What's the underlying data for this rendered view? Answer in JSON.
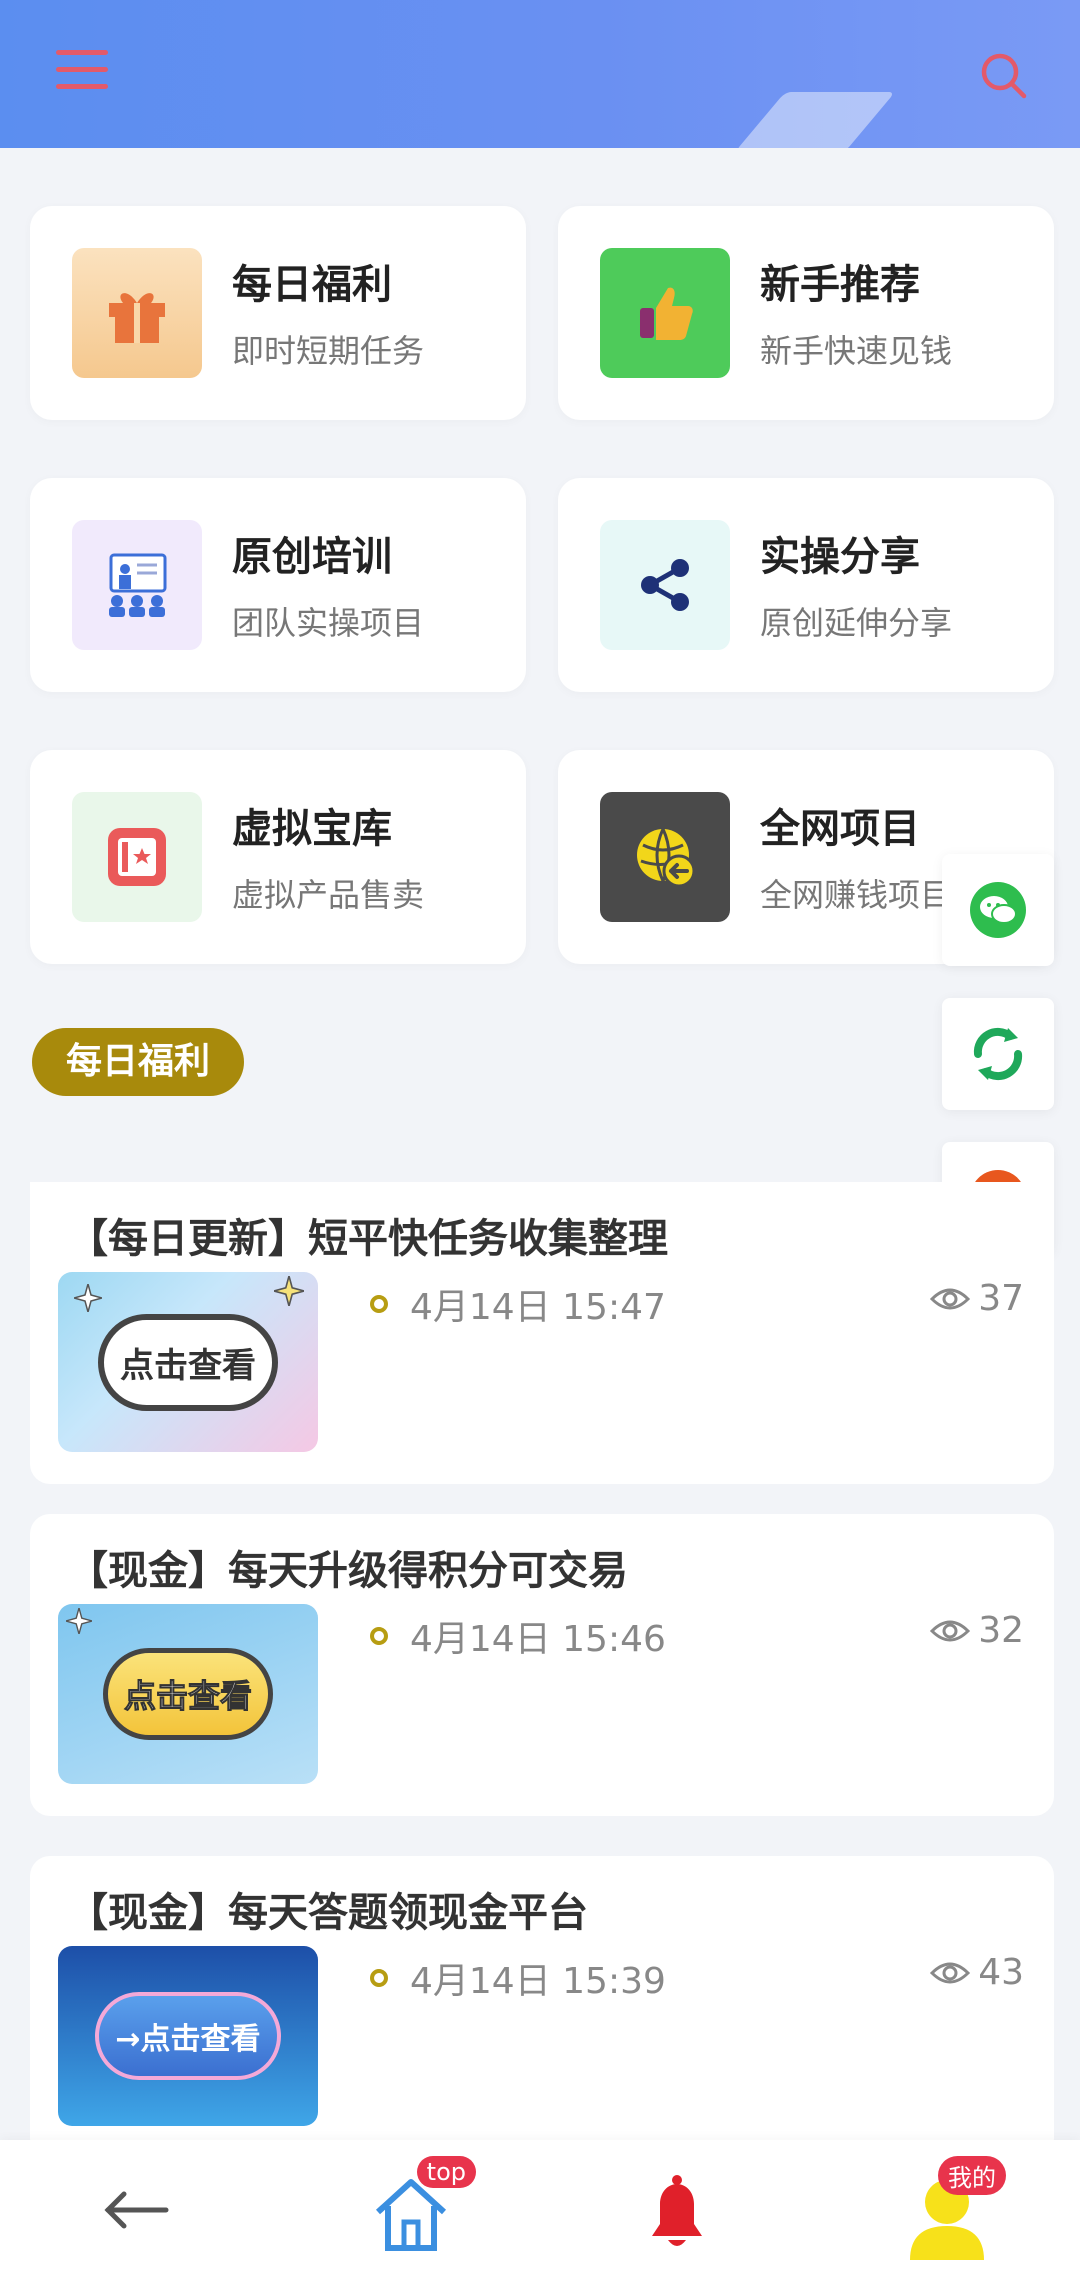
{
  "grid_items": [
    {
      "title": "每日福利",
      "subtitle": "即时短期任务",
      "icon": "gift-icon"
    },
    {
      "title": "新手推荐",
      "subtitle": "新手快速见钱",
      "icon": "thumbs-up-icon"
    },
    {
      "title": "原创培训",
      "subtitle": "团队实操项目",
      "icon": "training-icon"
    },
    {
      "title": "实操分享",
      "subtitle": "原创延伸分享",
      "icon": "share-icon"
    },
    {
      "title": "虚拟宝库",
      "subtitle": "虚拟产品售卖",
      "icon": "vault-icon"
    },
    {
      "title": "全网项目",
      "subtitle": "全网赚钱项目",
      "icon": "globe-icon"
    }
  ],
  "section_label": "每日福利",
  "articles": [
    {
      "title": "【每日更新】短平快任务收集整理",
      "date": "4月14日 15:47",
      "views": "37",
      "thumb_text": "点击查看"
    },
    {
      "title": "【现金】每天升级得积分可交易",
      "date": "4月14日 15:46",
      "views": "32",
      "thumb_text": "点击查看"
    },
    {
      "title": "【现金】每天答题领现金平台",
      "date": "4月14日 15:39",
      "views": "43",
      "thumb_text": "→点击查看"
    }
  ],
  "bottom_nav": {
    "home_badge": "top",
    "me_badge": "我的"
  },
  "colors": {
    "accent": "#a88a0c",
    "header": "#5b8ef0",
    "badge": "#e8344c"
  }
}
